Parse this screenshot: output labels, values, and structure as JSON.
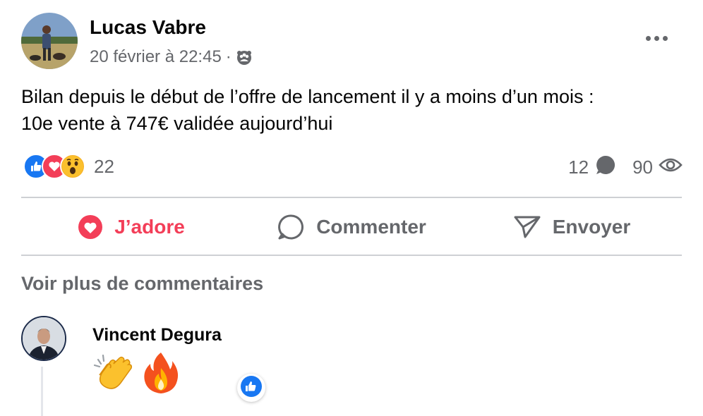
{
  "post": {
    "author_name": "Lucas Vabre",
    "timestamp": "20 février à 22:45",
    "separator": "·",
    "audience_icon": "friends-icon",
    "more_icon": "more-horizontal-icon",
    "text_line1": "Bilan depuis le début de l’offre de lancement il y a moins d’un mois :",
    "text_line2": "10e vente à 747€ validée aujourd’hui"
  },
  "stats": {
    "reaction_types": [
      "like-icon",
      "love-icon",
      "wow-icon"
    ],
    "reaction_count": "22",
    "comment_count": "12",
    "view_count": "90"
  },
  "actions": {
    "love_label": "J’adore",
    "comment_label": "Commenter",
    "send_label": "Envoyer"
  },
  "comments": {
    "more_label": "Voir plus de commentaires",
    "items": [
      {
        "author_name": "Vincent Degura",
        "emojis": [
          "clapping-hands-icon",
          "fire-icon"
        ],
        "reaction": "like-icon"
      }
    ]
  },
  "colors": {
    "love": "#f33e58",
    "like": "#1877f2",
    "secondary_text": "#65676b",
    "divider": "#ced0d4"
  }
}
